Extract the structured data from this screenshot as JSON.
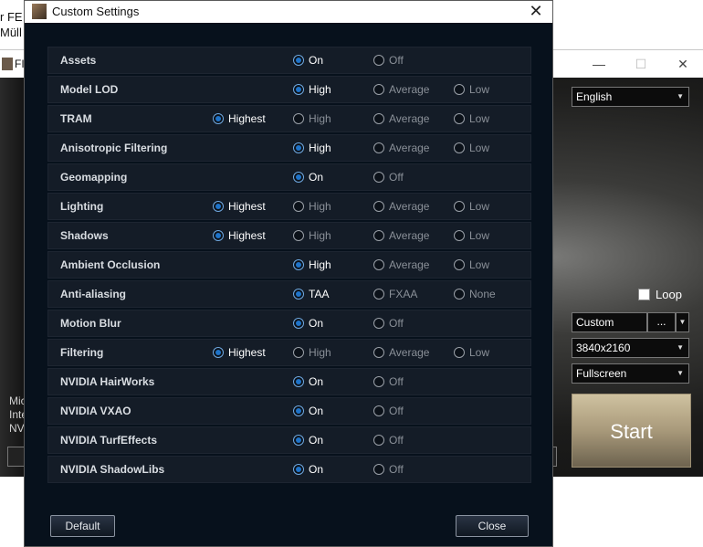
{
  "background": {
    "desktop_text": [
      "r FE",
      "Müll"
    ],
    "launcher": {
      "title": "FI",
      "minimize_glyph": "—",
      "maximize_glyph": "☐",
      "close_glyph": "✕",
      "left_text": [
        "Mic",
        "Inte",
        "NV"
      ],
      "language": "English",
      "loop_label": "Loop",
      "preset": "Custom",
      "preset_more": "...",
      "resolution": "3840x2160",
      "display_mode": "Fullscreen",
      "start_label": "Start"
    }
  },
  "dialog": {
    "title": "Custom Settings",
    "close_glyph": "✕",
    "settings": [
      {
        "label": "Assets",
        "options": [
          {
            "label": "On",
            "col": 2,
            "selected": true
          },
          {
            "label": "Off",
            "col": 3,
            "selected": false
          }
        ]
      },
      {
        "label": "Model LOD",
        "options": [
          {
            "label": "High",
            "col": 2,
            "selected": true
          },
          {
            "label": "Average",
            "col": 3,
            "selected": false
          },
          {
            "label": "Low",
            "col": 4,
            "selected": false
          }
        ]
      },
      {
        "label": "TRAM",
        "options": [
          {
            "label": "Highest",
            "col": 1,
            "selected": true
          },
          {
            "label": "High",
            "col": 2,
            "selected": false
          },
          {
            "label": "Average",
            "col": 3,
            "selected": false
          },
          {
            "label": "Low",
            "col": 4,
            "selected": false
          }
        ]
      },
      {
        "label": "Anisotropic Filtering",
        "options": [
          {
            "label": "High",
            "col": 2,
            "selected": true
          },
          {
            "label": "Average",
            "col": 3,
            "selected": false
          },
          {
            "label": "Low",
            "col": 4,
            "selected": false
          }
        ]
      },
      {
        "label": "Geomapping",
        "options": [
          {
            "label": "On",
            "col": 2,
            "selected": true
          },
          {
            "label": "Off",
            "col": 3,
            "selected": false
          }
        ]
      },
      {
        "label": "Lighting",
        "options": [
          {
            "label": "Highest",
            "col": 1,
            "selected": true
          },
          {
            "label": "High",
            "col": 2,
            "selected": false
          },
          {
            "label": "Average",
            "col": 3,
            "selected": false
          },
          {
            "label": "Low",
            "col": 4,
            "selected": false
          }
        ]
      },
      {
        "label": "Shadows",
        "options": [
          {
            "label": "Highest",
            "col": 1,
            "selected": true
          },
          {
            "label": "High",
            "col": 2,
            "selected": false
          },
          {
            "label": "Average",
            "col": 3,
            "selected": false
          },
          {
            "label": "Low",
            "col": 4,
            "selected": false
          }
        ]
      },
      {
        "label": "Ambient Occlusion",
        "options": [
          {
            "label": "High",
            "col": 2,
            "selected": true
          },
          {
            "label": "Average",
            "col": 3,
            "selected": false
          },
          {
            "label": "Low",
            "col": 4,
            "selected": false
          }
        ]
      },
      {
        "label": "Anti-aliasing",
        "options": [
          {
            "label": "TAA",
            "col": 2,
            "selected": true
          },
          {
            "label": "FXAA",
            "col": 3,
            "selected": false
          },
          {
            "label": "None",
            "col": 4,
            "selected": false
          }
        ]
      },
      {
        "label": "Motion Blur",
        "options": [
          {
            "label": "On",
            "col": 2,
            "selected": true
          },
          {
            "label": "Off",
            "col": 3,
            "selected": false
          }
        ]
      },
      {
        "label": "Filtering",
        "options": [
          {
            "label": "Highest",
            "col": 1,
            "selected": true
          },
          {
            "label": "High",
            "col": 2,
            "selected": false
          },
          {
            "label": "Average",
            "col": 3,
            "selected": false
          },
          {
            "label": "Low",
            "col": 4,
            "selected": false
          }
        ]
      },
      {
        "label": "NVIDIA HairWorks",
        "options": [
          {
            "label": "On",
            "col": 2,
            "selected": true
          },
          {
            "label": "Off",
            "col": 3,
            "selected": false
          }
        ]
      },
      {
        "label": "NVIDIA VXAO",
        "options": [
          {
            "label": "On",
            "col": 2,
            "selected": true
          },
          {
            "label": "Off",
            "col": 3,
            "selected": false
          }
        ]
      },
      {
        "label": "NVIDIA TurfEffects",
        "options": [
          {
            "label": "On",
            "col": 2,
            "selected": true
          },
          {
            "label": "Off",
            "col": 3,
            "selected": false
          }
        ]
      },
      {
        "label": "NVIDIA ShadowLibs",
        "options": [
          {
            "label": "On",
            "col": 2,
            "selected": true
          },
          {
            "label": "Off",
            "col": 3,
            "selected": false
          }
        ]
      }
    ],
    "default_label": "Default",
    "close_label": "Close"
  }
}
